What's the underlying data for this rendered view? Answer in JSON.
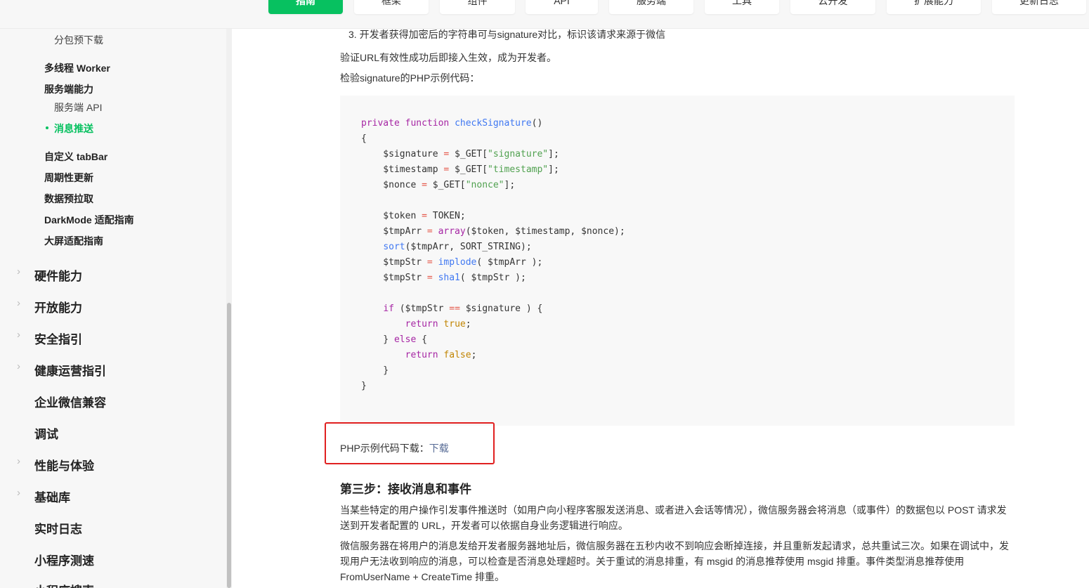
{
  "topnav": {
    "tabs": [
      {
        "label": "指南",
        "active": true
      },
      {
        "label": "框架"
      },
      {
        "label": "组件"
      },
      {
        "label": "API"
      },
      {
        "label": "服务端"
      },
      {
        "label": "工具"
      },
      {
        "label": "云开发"
      },
      {
        "label": "扩展能力"
      },
      {
        "label": "更新日志"
      }
    ]
  },
  "sidebar": {
    "items": [
      {
        "label": "分包预下载"
      },
      {
        "label": "多线程 Worker"
      },
      {
        "label": "服务端能力"
      },
      {
        "label": "服务端 API"
      },
      {
        "label": "消息推送",
        "active": true
      },
      {
        "label": "自定义 tabBar"
      },
      {
        "label": "周期性更新"
      },
      {
        "label": "数据预拉取"
      },
      {
        "label": "DarkMode 适配指南"
      },
      {
        "label": "大屏适配指南"
      }
    ],
    "sections": [
      {
        "label": "硬件能力"
      },
      {
        "label": "开放能力"
      },
      {
        "label": "安全指引"
      },
      {
        "label": "健康运营指引"
      },
      {
        "label": "企业微信兼容"
      },
      {
        "label": "调试"
      },
      {
        "label": "性能与体验"
      },
      {
        "label": "基础库"
      },
      {
        "label": "实时日志"
      },
      {
        "label": "小程序测速"
      },
      {
        "label": "小程序搜索"
      }
    ]
  },
  "content": {
    "step3_item": "3. 开发者获得加密后的字符串可与signature对比，标识该请求来源于微信",
    "verify_text": "验证URL有效性成功后即接入生效，成为开发者。",
    "php_sample_label": "检验signature的PHP示例代码：",
    "code": {
      "l1_kw": "private function ",
      "l1_fn": "checkSignature",
      "l1_rest": "()",
      "brace_open": "{",
      "brace_close": "}",
      "s_signature": "\"signature\"",
      "s_timestamp": "\"timestamp\"",
      "s_nonce": "\"nonce\"",
      "token_const": "TOKEN",
      "array_fn": "array",
      "sort_fn": "sort",
      "sort_const": "SORT_STRING",
      "implode_fn": "implode",
      "sha1_fn": "sha1",
      "if_kw": "if",
      "else_kw": "else",
      "return_kw": "return",
      "true_lit": "true",
      "false_lit": "false"
    },
    "download_label": "PHP示例代码下载：",
    "download_link": "下载",
    "step3_title": "第三步：接收消息和事件",
    "para1": "当某些特定的用户操作引发事件推送时（如用户向小程序客服发送消息、或者进入会话等情况），微信服务器会将消息（或事件）的数据包以 POST 请求发送到开发者配置的 URL，开发者可以依据自身业务逻辑进行响应。",
    "para2": "微信服务器在将用户的消息发给开发者服务器地址后，微信服务器在五秒内收不到响应会断掉连接，并且重新发起请求，总共重试三次。如果在调试中，发现用户无法收到响应的消息，可以检查是否消息处理超时。关于重试的消息排重，有 msgid 的消息推荐使用 msgid 排重。事件类型消息推荐使用 FromUserName + CreateTime 排重。"
  },
  "colors": {
    "accent": "#07c160",
    "highlight_border": "#e02020",
    "link": "#576b95"
  }
}
